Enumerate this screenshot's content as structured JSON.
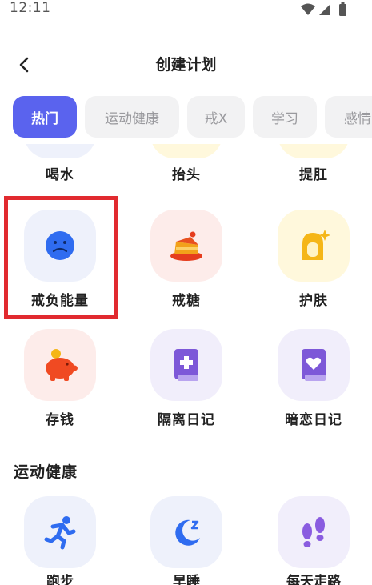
{
  "status_bar": {
    "time": "12:11"
  },
  "header": {
    "title": "创建计划"
  },
  "tabs": [
    {
      "label": "热门",
      "active": true
    },
    {
      "label": "运动健康",
      "active": false
    },
    {
      "label": "戒X",
      "active": false
    },
    {
      "label": "学习",
      "active": false
    },
    {
      "label": "感情",
      "active": false
    }
  ],
  "partial_row": [
    {
      "label": "喝水",
      "bg": "#eef1fb"
    },
    {
      "label": "抬头",
      "bg": "#fff8dc"
    },
    {
      "label": "提肛",
      "bg": "#fff8dc"
    }
  ],
  "rows": [
    [
      {
        "label": "戒负能量",
        "icon": "sad-face-icon",
        "bg": "#eef1fb",
        "highlighted": true
      },
      {
        "label": "戒糖",
        "icon": "cake-icon",
        "bg": "#fdecea"
      },
      {
        "label": "护肤",
        "icon": "girl-sparkle-icon",
        "bg": "#fff8dc"
      }
    ],
    [
      {
        "label": "存钱",
        "icon": "piggy-bank-icon",
        "bg": "#fdecea"
      },
      {
        "label": "隔离日记",
        "icon": "medical-book-icon",
        "bg": "#f1eefb"
      },
      {
        "label": "暗恋日记",
        "icon": "heart-book-icon",
        "bg": "#f1eefb"
      }
    ]
  ],
  "section": {
    "title": "运动健康"
  },
  "section_row": [
    {
      "label": "跑步",
      "icon": "running-icon",
      "bg": "#eef1fb"
    },
    {
      "label": "早睡",
      "icon": "moon-sleep-icon",
      "bg": "#eef1fb"
    },
    {
      "label": "每天走路",
      "icon": "footprints-icon",
      "bg": "#f1eefb"
    }
  ],
  "colors": {
    "accent": "#5a63ee",
    "highlight_border": "#e12a2f"
  }
}
